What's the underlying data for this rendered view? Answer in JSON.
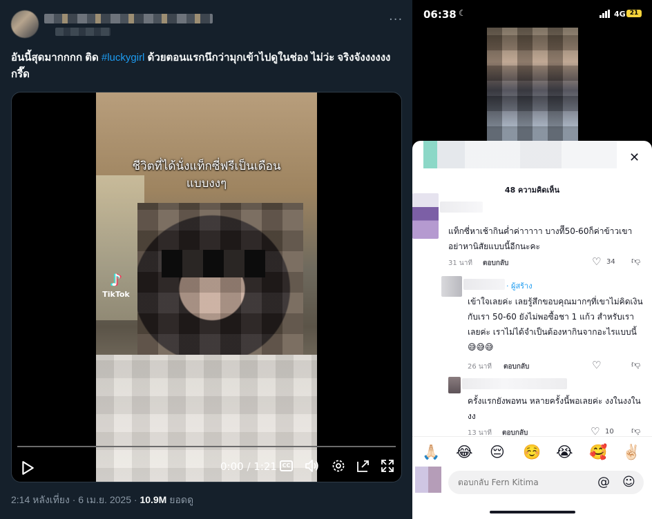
{
  "tweet": {
    "more_label": "···",
    "text_before": "อันนี้สุดมากกกก ติด ",
    "hashtag": "#luckygirl",
    "text_after": " ด้วยตอนแรกนึกว่ามุกเข้าไปดูในช่อง ไม่ว่ะ จริงจังงงงงง กรี๊ด",
    "video": {
      "overlay_text_line1": "ชีวิตที่ได้นั่งแท็กซี่ฟรีเป็นเดือน",
      "overlay_text_line2": "แบบงงๆ",
      "watermark": "TikTok",
      "time": "0:00 / 1:21",
      "progress": 0.0
    },
    "meta_time": "2:14 หลังเที่ยง · 6 เม.ย. 2025 · ",
    "views_value": "10.9M",
    "views_label": " ยอดดู"
  },
  "phone": {
    "status": {
      "clock": "06:38",
      "network": "4G",
      "battery": "21"
    },
    "comment_count": "48 ความคิดเห็น",
    "comments": [
      {
        "text": "แท็กซี่หาเช้ากินค่ำค่าาาาา บางทีี50-60ก็ค่าข้าวเขา อย่าหานิสัยแบบนี้อีกนะคะ",
        "time": "31 นาที",
        "reply": "ตอบกลับ",
        "likes": "34"
      },
      {
        "creator_badge": "· ผู้สร้าง",
        "text": "เข้าใจเลยค่ะ เลยรู้สึกขอบคุณมากๆที่เขาไม่คิดเงินกับเรา 50-60 ยังไม่พอซื้อชา 1 แก้ว สำหรับเราเลยค่ะ เราไม่ได้จำเป็นต้องหากินจากอะไรแบบนี้ 😅😅😅",
        "time": "26 นาที",
        "reply": "ตอบกลับ"
      },
      {
        "text": "ครั้งแรกยังพอทน หลายครั้งนี้พอเลยค่ะ งงในงงในงง",
        "time": "13 นาที",
        "reply": "ตอบกลับ",
        "likes": "10"
      }
    ],
    "emojis": [
      "🙏🏻",
      "😂",
      "😔",
      "☺️",
      "😭",
      "🥰",
      "✌🏻"
    ],
    "reply_placeholder": "ตอบกลับ Fern Kitima"
  }
}
